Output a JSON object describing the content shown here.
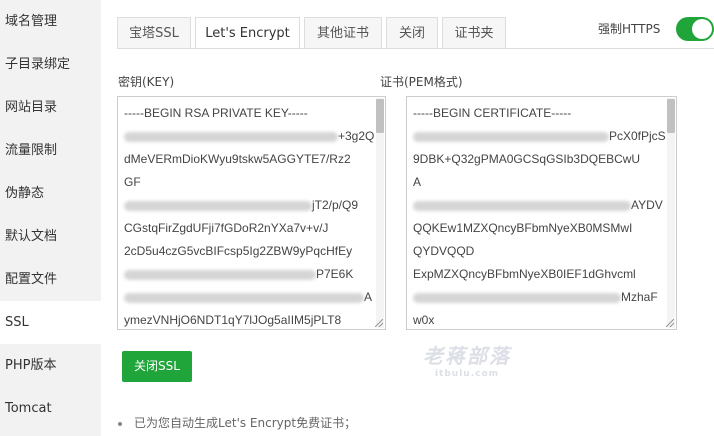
{
  "sidebar": {
    "items": [
      {
        "label": "域名管理"
      },
      {
        "label": "子目录绑定"
      },
      {
        "label": "网站目录"
      },
      {
        "label": "流量限制"
      },
      {
        "label": "伪静态"
      },
      {
        "label": "默认文档"
      },
      {
        "label": "配置文件"
      },
      {
        "label": "SSL"
      },
      {
        "label": "PHP版本"
      },
      {
        "label": "Tomcat"
      }
    ],
    "active": "SSL"
  },
  "tabs": [
    {
      "label": "宝塔SSL"
    },
    {
      "label": "Let's Encrypt"
    },
    {
      "label": "其他证书"
    },
    {
      "label": "关闭"
    },
    {
      "label": "证书夹"
    }
  ],
  "active_tab": "Let's Encrypt",
  "force_https": {
    "label": "强制HTTPS",
    "enabled": true,
    "color": "#20a53a"
  },
  "key_panel": {
    "label": "密钥(KEY)",
    "lines": [
      "-----BEGIN RSA PRIVATE KEY-----",
      "+3g2Q",
      "dMeVERmDioKWyu9tskw5AGGYTE7/Rz2",
      "GF",
      "jT2/p/Q9",
      "CGstqFirZgdUFji7fGDoR2nYXa7v+v/J",
      "2cD5u4czG5vcBIFcsp5Ig2ZBW9yPqcHfEy",
      "P7E6K",
      "A",
      "ymezVNHjO6NDT1qY7lJOg5aIIM5jPLT8"
    ]
  },
  "cert_panel": {
    "label": "证书(PEM格式)",
    "lines": [
      "-----BEGIN CERTIFICATE-----",
      "PcX0fPjcS",
      "9DBK+Q32gPMA0GCSqGSIb3DQEBCwU",
      "A",
      "AYDV",
      "QQKEw1MZXQncyBFbmNyeXB0MSMwI",
      "QYDVQQD",
      "ExpMZXQncyBFbmNyeXB0IEF1dGhvcml",
      "MzhaF",
      "w0x"
    ]
  },
  "close_ssl_button": {
    "label": "关闭SSL",
    "color": "#20a53a"
  },
  "watermark": {
    "main": "老蒋部落",
    "sub": "itbulu.com"
  },
  "notes": [
    {
      "text": "已为您自动生成Let's Encrypt免费证书；"
    }
  ]
}
